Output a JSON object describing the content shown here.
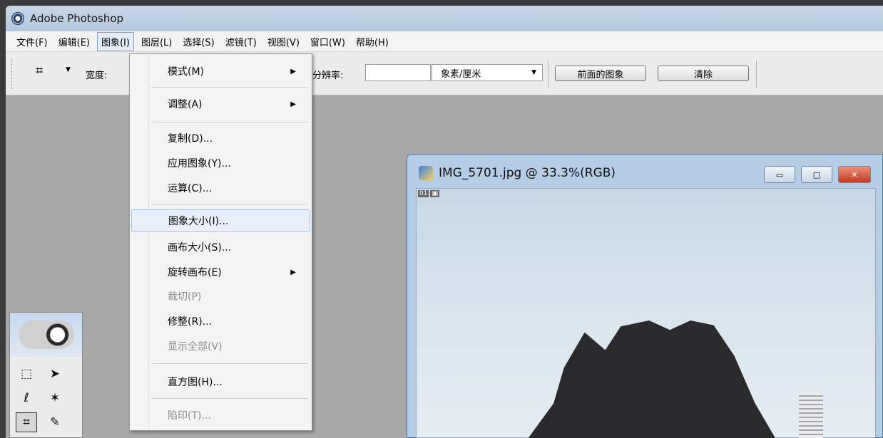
{
  "window": {
    "title": "Adobe Photoshop"
  },
  "menubar": {
    "items": [
      "文件(F)",
      "编辑(E)",
      "图象(I)",
      "图层(L)",
      "选择(S)",
      "滤镜(T)",
      "视图(V)",
      "窗口(W)",
      "帮助(H)"
    ]
  },
  "options": {
    "width_label": "宽度:",
    "resolution_label": "分辨率:",
    "units_select": "象素/厘米",
    "front_image_button": "前面的图象",
    "clear_button": "清除"
  },
  "image_menu": {
    "items": [
      {
        "label": "模式(M)",
        "submenu": true,
        "disabled": false
      },
      {
        "label": "调整(A)",
        "submenu": true,
        "disabled": false
      },
      {
        "label": "复制(D)...",
        "submenu": false,
        "disabled": false
      },
      {
        "label": "应用图象(Y)...",
        "submenu": false,
        "disabled": false
      },
      {
        "label": "运算(C)...",
        "submenu": false,
        "disabled": false
      },
      {
        "label": "图象大小(I)...",
        "submenu": false,
        "disabled": false,
        "highlighted": true
      },
      {
        "label": "画布大小(S)...",
        "submenu": false,
        "disabled": false
      },
      {
        "label": "旋转画布(E)",
        "submenu": true,
        "disabled": false
      },
      {
        "label": "裁切(P)",
        "submenu": false,
        "disabled": true
      },
      {
        "label": "修整(R)...",
        "submenu": false,
        "disabled": false
      },
      {
        "label": "显示全部(V)",
        "submenu": false,
        "disabled": true
      },
      {
        "label": "直方图(H)...",
        "submenu": false,
        "disabled": false
      },
      {
        "label": "陷印(T)...",
        "submenu": false,
        "disabled": true
      }
    ]
  },
  "document": {
    "title": "IMG_5701.jpg @ 33.3%(RGB)",
    "layer_badge": "01"
  },
  "colors": {
    "accent": "#7da2ce",
    "workspace": "#a8a8a8"
  }
}
